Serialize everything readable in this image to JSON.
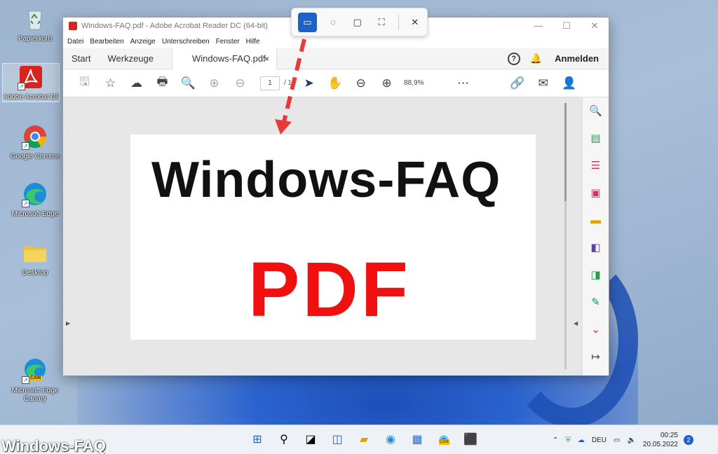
{
  "desktop": {
    "icons": [
      {
        "label": "Papierkorb"
      },
      {
        "label": "Adobe Acrobat DC"
      },
      {
        "label": "Google Chrome"
      },
      {
        "label": "Microsoft Edge"
      },
      {
        "label": "Desktop"
      },
      {
        "label": "Microsoft Edge Canary",
        "badge": "CAN"
      }
    ]
  },
  "window": {
    "title": "Windows-FAQ.pdf - Adobe Acrobat Reader DC (64-bit)",
    "menu": [
      "Datei",
      "Bearbeiten",
      "Anzeige",
      "Unterschreiben",
      "Fenster",
      "Hilfe"
    ],
    "tabs": {
      "start": "Start",
      "tools": "Werkzeuge",
      "doc": "Windows-FAQ.pdf",
      "close": "×"
    },
    "help": "?",
    "login": "Anmelden",
    "toolbar": {
      "page_current": "1",
      "page_sep": "/ 1",
      "zoom": "88,9%"
    }
  },
  "pdf_content": {
    "title": "Windows-FAQ",
    "big": "PDF"
  },
  "taskbar": {
    "lang": "DEU",
    "time": "00:25",
    "date": "20.05.2022",
    "notifications": "2",
    "canary_badge": "CAN"
  },
  "watermark": "Windows-FAQ",
  "colors": {
    "accent": "#1b63c9",
    "pdf_red": "#f01010",
    "acrobat_red": "#d8231f"
  }
}
